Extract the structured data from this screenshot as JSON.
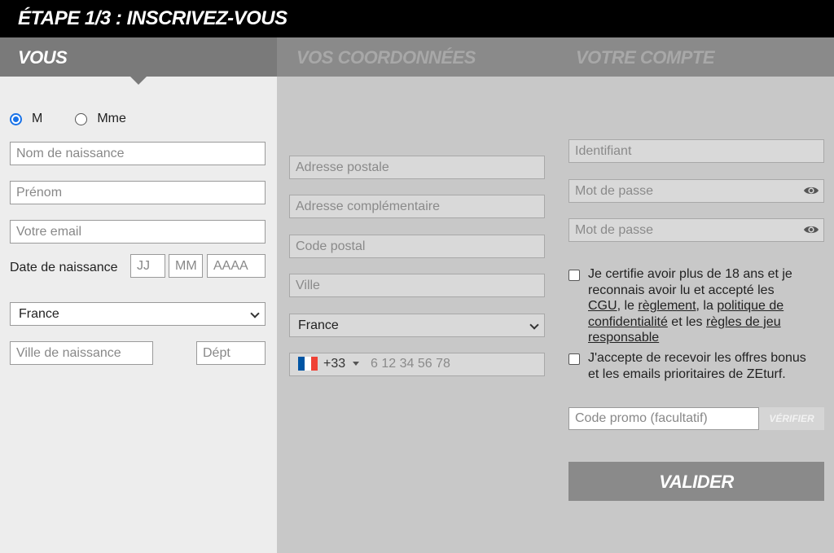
{
  "header": {
    "title": "ÉTAPE 1/3 : INSCRIVEZ-VOUS"
  },
  "tabs": [
    {
      "label": "VOUS",
      "active": true
    },
    {
      "label": "VOS COORDONNÉES",
      "active": false
    },
    {
      "label": "VOTRE COMPTE",
      "active": false
    }
  ],
  "vous": {
    "civility": {
      "options": [
        "M",
        "Mme"
      ],
      "selected": "M"
    },
    "birth_name_placeholder": "Nom de naissance",
    "first_name_placeholder": "Prénom",
    "email_placeholder": "Votre email",
    "dob_label": "Date de naissance",
    "dob_day_placeholder": "JJ",
    "dob_month_placeholder": "MM",
    "dob_year_placeholder": "AAAA",
    "birth_country": "France",
    "birth_city_placeholder": "Ville de naissance",
    "dept_placeholder": "Dépt"
  },
  "coordonnees": {
    "address_placeholder": "Adresse postale",
    "address2_placeholder": "Adresse complémentaire",
    "postal_code_placeholder": "Code postal",
    "city_placeholder": "Ville",
    "country": "France",
    "phone_country_code": "+33",
    "phone_placeholder": "6 12 34 56 78",
    "flag_colors": [
      "#0055a4",
      "#ffffff",
      "#ef4135"
    ]
  },
  "compte": {
    "username_placeholder": "Identifiant",
    "password_placeholder": "Mot de passe",
    "password_confirm_placeholder": "Mot de passe",
    "certify": {
      "t1": "Je certifie avoir plus de 18 ans et je",
      "t2": "reconnais avoir lu et accepté les",
      "cgu": "CGU",
      "t3": ", le ",
      "reglement": "règlement",
      "t4": ", la ",
      "politique1": "politique de",
      "politique2": "confidentialité",
      "t5": " et les ",
      "regles1": "règles de jeu",
      "regles2": "responsable"
    },
    "offers": {
      "t1": "J'accepte de recevoir les offres bonus",
      "t2": "et les emails prioritaires de ZEturf."
    },
    "promo_placeholder": "Code promo (facultatif)",
    "verify_label": "VÉRIFIER",
    "submit_label": "VALIDER"
  }
}
